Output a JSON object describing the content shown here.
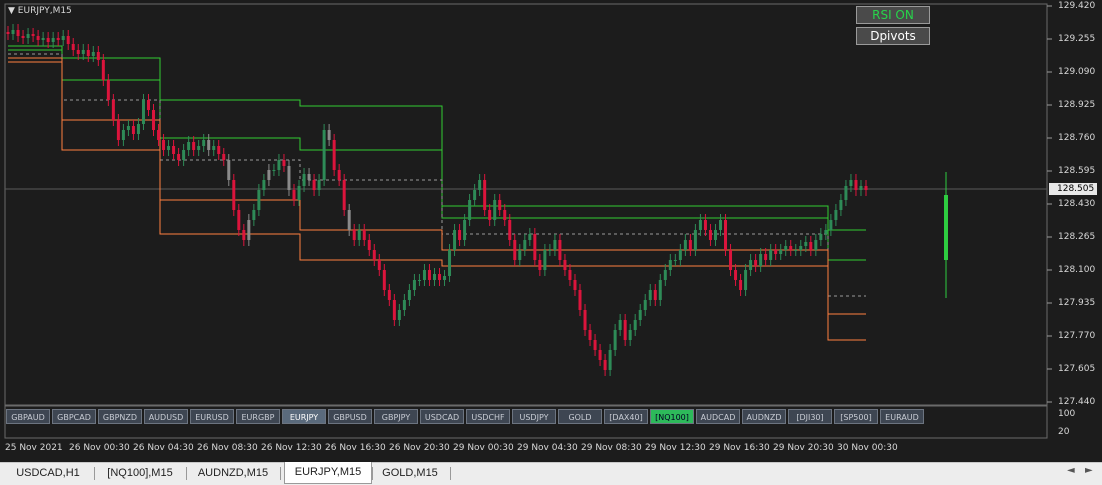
{
  "chart": {
    "symbol_title": "EURJPY,M15",
    "current_price": "128.505",
    "colors": {
      "background": "#1c1c1c",
      "bull": "#2e8b57",
      "bear": "#dc143c",
      "neutral": "#8a8a8a",
      "pivot_resistance": "#32cd32",
      "pivot_support": "#ff7f3f",
      "pivot_mid": "#9a9a9a"
    },
    "price_axis": [
      "129.420",
      "129.255",
      "129.090",
      "128.925",
      "128.760",
      "128.595",
      "128.430",
      "128.265",
      "128.100",
      "127.935",
      "127.770",
      "127.605",
      "127.440"
    ],
    "time_axis": [
      "25 Nov 2021",
      "26 Nov 00:30",
      "26 Nov 04:30",
      "26 Nov 08:30",
      "26 Nov 12:30",
      "26 Nov 16:30",
      "26 Nov 20:30",
      "29 Nov 00:30",
      "29 Nov 04:30",
      "29 Nov 08:30",
      "29 Nov 12:30",
      "29 Nov 16:30",
      "29 Nov 20:30",
      "30 Nov 00:30"
    ],
    "indicator_axis": [
      "100",
      "20"
    ]
  },
  "chart_data": {
    "type": "candlestick",
    "ylim": [
      127.44,
      129.42
    ],
    "closes": [
      129.28,
      129.3,
      129.27,
      129.26,
      129.28,
      129.27,
      129.25,
      129.26,
      129.24,
      129.26,
      129.25,
      129.27,
      129.23,
      129.2,
      129.18,
      129.2,
      129.17,
      129.19,
      129.15,
      129.05,
      128.95,
      128.85,
      128.75,
      128.8,
      128.82,
      128.78,
      128.83,
      128.95,
      128.9,
      128.8,
      128.75,
      128.7,
      128.72,
      128.68,
      128.65,
      128.7,
      128.74,
      128.7,
      128.72,
      128.75,
      128.7,
      128.72,
      128.68,
      128.65,
      128.55,
      128.4,
      128.3,
      128.25,
      128.35,
      128.4,
      128.5,
      128.55,
      128.6,
      128.6,
      128.65,
      128.62,
      128.5,
      128.45,
      128.52,
      128.58,
      128.55,
      128.5,
      128.55,
      128.8,
      128.75,
      128.6,
      128.55,
      128.4,
      128.3,
      128.25,
      128.3,
      128.25,
      128.2,
      128.15,
      128.1,
      128.0,
      127.95,
      127.85,
      127.9,
      127.95,
      128.0,
      128.05,
      128.05,
      128.1,
      128.05,
      128.08,
      128.05,
      128.07,
      128.2,
      128.3,
      128.25,
      128.35,
      128.45,
      128.5,
      128.55,
      128.4,
      128.35,
      128.45,
      128.4,
      128.35,
      128.25,
      128.15,
      128.2,
      128.25,
      128.28,
      128.15,
      128.1,
      128.2,
      128.2,
      128.25,
      128.15,
      128.1,
      128.05,
      128.0,
      127.9,
      127.8,
      127.75,
      127.7,
      127.65,
      127.6,
      127.7,
      127.8,
      127.85,
      127.75,
      127.8,
      127.85,
      127.9,
      127.95,
      128.0,
      127.95,
      128.05,
      128.1,
      128.15,
      128.15,
      128.2,
      128.25,
      128.2,
      128.3,
      128.35,
      128.3,
      128.25,
      128.3,
      128.35,
      128.2,
      128.1,
      128.05,
      128.0,
      128.1,
      128.15,
      128.12,
      128.18,
      128.15,
      128.2,
      128.18,
      128.2,
      128.22,
      128.2,
      128.2,
      128.22,
      128.24,
      128.2,
      128.25,
      128.28,
      128.3,
      128.35,
      128.4,
      128.45,
      128.52,
      128.55,
      128.5,
      128.52,
      128.5
    ],
    "pivot_levels": {
      "R2": [
        129.22,
        129.22,
        129.16,
        129.16,
        128.95,
        128.95,
        128.92,
        128.92,
        128.42,
        128.42,
        128.3,
        128.3
      ],
      "R1": [
        129.2,
        129.2,
        129.05,
        129.05,
        128.76,
        128.76,
        128.7,
        128.7,
        128.36,
        128.36,
        128.15,
        128.15
      ],
      "PP": [
        129.18,
        129.18,
        128.95,
        128.95,
        128.65,
        128.65,
        128.55,
        128.55,
        128.28,
        128.28,
        127.97,
        127.97
      ],
      "S1": [
        129.16,
        129.16,
        128.85,
        128.85,
        128.45,
        128.45,
        128.3,
        128.3,
        128.2,
        128.2,
        127.88,
        127.88
      ],
      "S2": [
        129.14,
        129.14,
        128.7,
        128.7,
        128.28,
        128.28,
        128.15,
        128.15,
        128.12,
        128.12,
        127.75,
        127.75
      ]
    }
  },
  "buttons": {
    "rsi": "RSI ON",
    "dpivots": "Dpivots"
  },
  "symbols": [
    "GBPAUD",
    "GBPCAD",
    "GBPNZD",
    "AUDUSD",
    "EURUSD",
    "EURGBP",
    "EURJPY",
    "GBPUSD",
    "GBPJPY",
    "USDCAD",
    "USDCHF",
    "USDJPY",
    "GOLD",
    "[DAX40]",
    "[NQ100]",
    "AUDCAD",
    "AUDNZD",
    "[DJI30]",
    "[SP500]",
    "EURAUD"
  ],
  "tabs": [
    "USDCAD,H1",
    "[NQ100],M15",
    "AUDNZD,M15",
    "EURJPY,M15",
    "GOLD,M15"
  ],
  "active_tab": "EURJPY,M15"
}
